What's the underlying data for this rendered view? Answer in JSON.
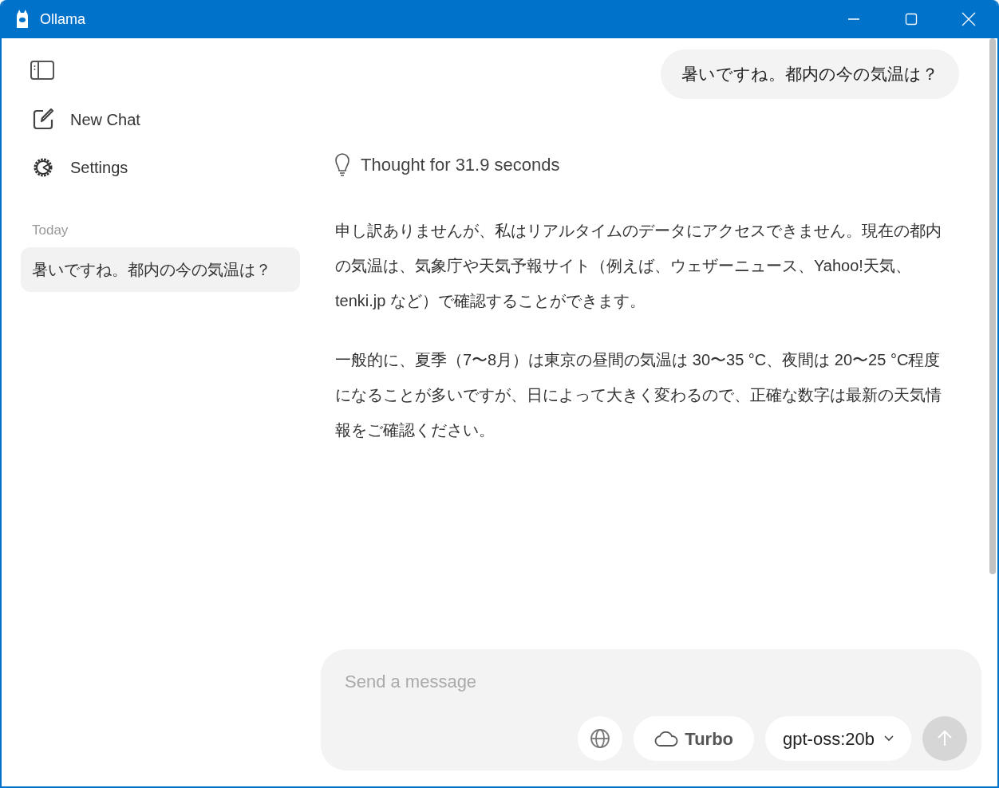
{
  "window": {
    "title": "Ollama"
  },
  "sidebar": {
    "items": [
      {
        "kind": "new",
        "label": "New Chat"
      },
      {
        "kind": "settings",
        "label": "Settings"
      }
    ],
    "section": "Today",
    "chats": [
      {
        "title": "暑いですね。都内の今の気温は？",
        "selected": true
      }
    ]
  },
  "conversation": {
    "user_message": "暑いですね。都内の今の気温は？",
    "thought": "Thought for 31.9 seconds",
    "paragraphs": [
      "申し訳ありませんが、私はリアルタイムのデータにアクセスできません。現在の都内の気温は、気象庁や天気予報サイト（例えば、ウェザーニュース、Yahoo!天気、tenki.jp など）で確認することができます。",
      "一般的に、夏季（7〜8月）は東京の昼間の気温は 30〜35 °C、夜間は 20〜25 °C程度になることが多いですが、日によって大きく変わるので、正確な数字は最新の天気情報をご確認ください。"
    ]
  },
  "composer": {
    "placeholder": "Send a message",
    "turbo": "Turbo",
    "model": "gpt-oss:20b",
    "send_disabled": true
  }
}
